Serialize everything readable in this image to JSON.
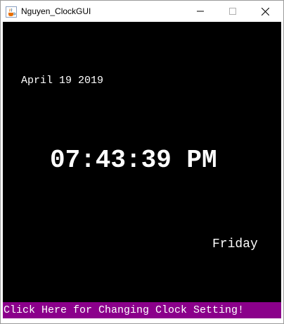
{
  "window": {
    "title": "Nguyen_ClockGUI",
    "app_icon": "java-cup-icon"
  },
  "titlebar_buttons": {
    "minimize_icon": "minimize-icon",
    "maximize_icon": "maximize-icon",
    "close_icon": "close-icon"
  },
  "clock": {
    "date": "April 19 2019",
    "time": "07:43:39 PM",
    "day": "Friday",
    "background_color": "#000000",
    "text_color": "#ffffff"
  },
  "settings_bar": {
    "label": "Click Here for Changing Clock Setting!",
    "background_color": "#8b008b"
  }
}
